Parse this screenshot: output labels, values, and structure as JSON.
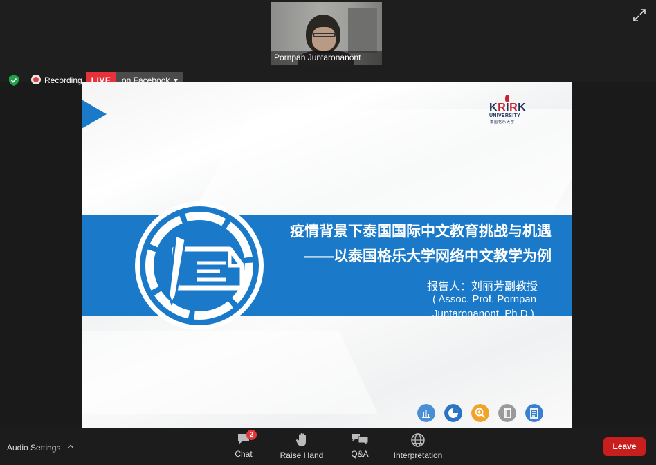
{
  "meeting": {
    "participant_name": "Pornpan Juntaronanont",
    "recording_label": "Recording",
    "live_badge": "LIVE",
    "live_target": "on Facebook"
  },
  "slide": {
    "logo_word_prefix": "K",
    "logo_word_r1": "R",
    "logo_word_i": "I",
    "logo_word_r2": "R",
    "logo_word_suffix": "K",
    "logo_sub": "UNIVERSITY",
    "logo_cn": "泰国格乐大学",
    "title_line1": "疫情背景下泰国国际中文教育挑战与机遇",
    "title_line2": "——以泰国格乐大学网络中文教学为例",
    "presenter_cn": "报告人：刘丽芳副教授",
    "presenter_en_line1": "( Assoc. Prof. Pornpan",
    "presenter_en_line2": "Juntaronanont, Ph.D.)",
    "accent_color": "#1a7ac9"
  },
  "toolbar": {
    "audio_settings": "Audio Settings",
    "chat": "Chat",
    "chat_badge": "2",
    "raise_hand": "Raise Hand",
    "qa": "Q&A",
    "interpretation": "Interpretation",
    "leave": "Leave"
  }
}
